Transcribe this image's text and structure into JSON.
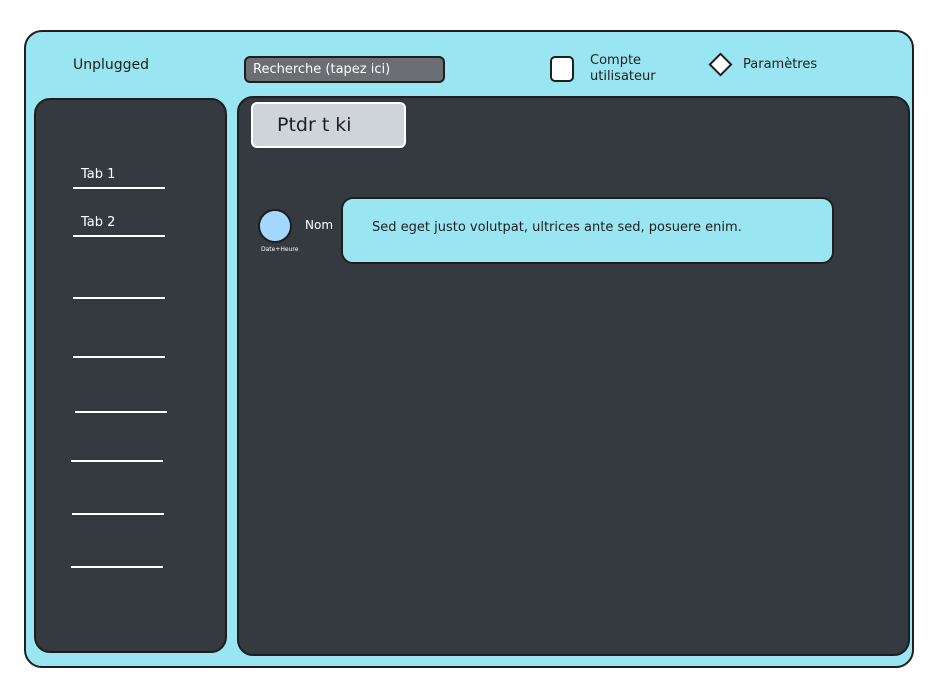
{
  "header": {
    "app_title": "Unplugged",
    "search_placeholder": "Recherche (tapez ici)",
    "account_label": "Compte utilisateur",
    "settings_label": "Paramètres"
  },
  "sidebar": {
    "tabs": [
      {
        "label": "Tab 1"
      },
      {
        "label": "Tab 2"
      }
    ],
    "empty_slots": 6
  },
  "main": {
    "channel_title": "Ptdr t ki",
    "messages": [
      {
        "author": "Nom",
        "datetime": "Date+Heure",
        "text": "Sed eget justo volutpat, ultrices ante sed, posuere enim."
      }
    ]
  },
  "colors": {
    "frame": "#99e6f2",
    "panel": "#343a40",
    "avatar": "#a5d8ff",
    "title_box": "#ced4da",
    "search_bg": "#6b6e73"
  }
}
